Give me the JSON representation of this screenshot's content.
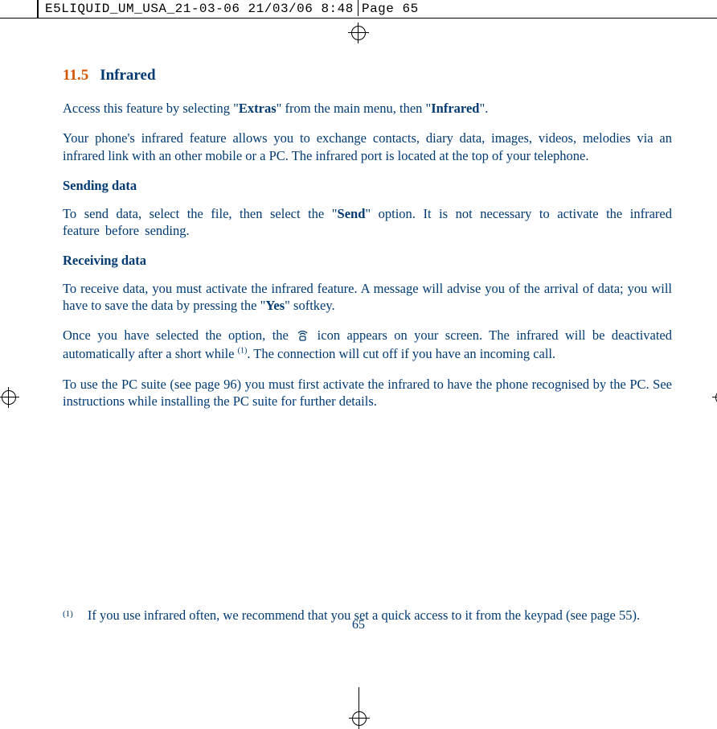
{
  "header": {
    "text": "E5LIQUID_UM_USA_21-03-06  21/03/06  8:48  Page 65"
  },
  "section": {
    "number": "11.5",
    "name": "Infrared"
  },
  "p1": {
    "pre": "Access this feature by selecting \"",
    "b1": "Extras",
    "mid": "\" from the main menu, then \"",
    "b2": "Infrared",
    "post": "\"."
  },
  "p2": "Your phone's infrared feature allows you to exchange contacts, diary data, images, videos, melodies via an infrared link with an other mobile or a PC. The infrared port is located at the top of your telephone.",
  "sub1": "Sending data",
  "p3": {
    "pre": "To send data, select the file, then select the \"",
    "b1": "Send",
    "post": "\" option. It is not necessary to activate the infrared feature before sending."
  },
  "sub2": "Receiving data",
  "p4": {
    "pre": "To receive data, you must activate the infrared feature. A message will advise you of the arrival of data; you will have to save the data by pressing the \"",
    "b1": "Yes",
    "post": "\" softkey."
  },
  "p5": {
    "pre": "Once you have selected the option, the ",
    "post_icon": " icon appears on your screen. The infrared will be deactivated automatically after a short while ",
    "sup": "(1)",
    "post": ". The connection will cut off if you have an incoming call."
  },
  "p6": "To use the PC suite (see page 96) you must first activate the infrared to have the phone recognised by the PC. See instructions while installing the PC suite for further details.",
  "footnote": {
    "marker": "(1)",
    "text": "If you use infrared often, we recommend that you set a quick access to it from the keypad (see page 55)."
  },
  "pagenum": "65"
}
